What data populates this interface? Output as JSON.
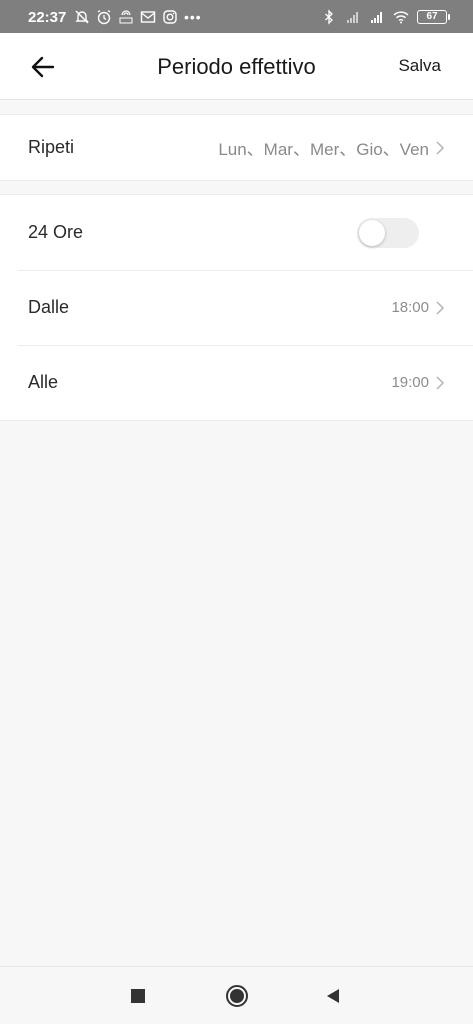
{
  "status_bar": {
    "time": "22:37",
    "battery": "67",
    "left_icons": [
      "muted-bell-icon",
      "alarm-icon",
      "hotspot-icon",
      "mail-icon",
      "instagram-icon"
    ],
    "right_icons": [
      "bluetooth-icon",
      "signal-icon",
      "signal-icon",
      "wifi-icon"
    ],
    "more": "•••"
  },
  "header": {
    "title": "Periodo effettivo",
    "save_label": "Salva",
    "back_icon": "arrow-left-icon"
  },
  "repeat": {
    "label": "Ripeti",
    "value": "Lun、Mar、Mer、Gio、Ven"
  },
  "schedule": {
    "all_day_label": "24 Ore",
    "all_day_enabled": false,
    "from_label": "Dalle",
    "from_value": "18:00",
    "to_label": "Alle",
    "to_value": "19:00"
  },
  "colors": {
    "status_bar": "#7f7f7f",
    "background": "#f7f7f7",
    "card": "#ffffff",
    "secondary_text": "#8d8d8d"
  },
  "nav_bar": {
    "icons": [
      "recents-square-icon",
      "home-circle-icon",
      "back-triangle-icon"
    ]
  }
}
